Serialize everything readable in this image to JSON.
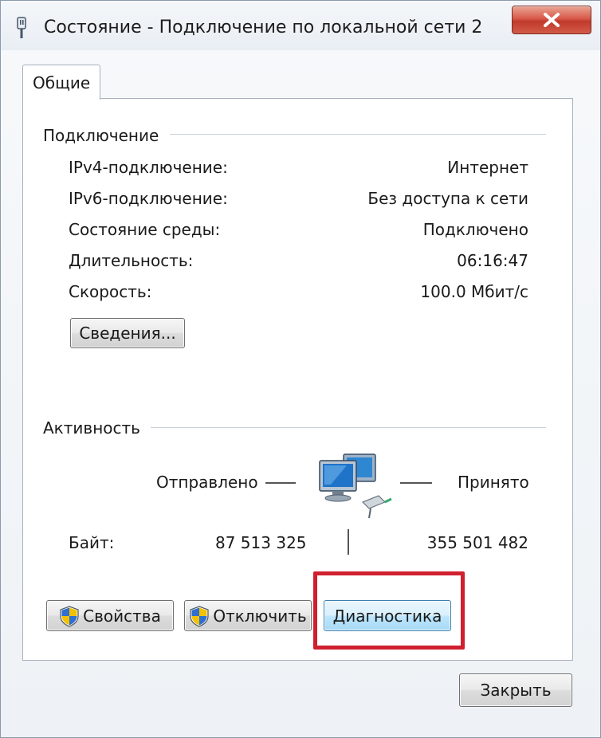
{
  "window": {
    "title": "Состояние - Подключение по локальной сети 2"
  },
  "icons": {
    "title": "network-connection-icon",
    "close": "close-x-icon",
    "activity": "network-computers-icon",
    "shield": "uac-shield-icon"
  },
  "colors": {
    "close_button": "#c7402f",
    "highlight": "#d0202f",
    "diag_button": "#bee6fd"
  },
  "tabs": [
    {
      "label": "Общие",
      "selected": true
    }
  ],
  "connection": {
    "group_label": "Подключение",
    "rows": [
      {
        "label": "IPv4-подключение:",
        "value": "Интернет"
      },
      {
        "label": "IPv6-подключение:",
        "value": "Без доступа к сети"
      },
      {
        "label": "Состояние среды:",
        "value": "Подключено"
      },
      {
        "label": "Длительность:",
        "value": "06:16:47"
      },
      {
        "label": "Скорость:",
        "value": "100.0 Мбит/с"
      }
    ],
    "details_button": "Сведения..."
  },
  "activity": {
    "group_label": "Активность",
    "sent_label": "Отправлено",
    "received_label": "Принято",
    "bytes_label": "Байт:",
    "bytes_sent": "87 513 325",
    "bytes_received": "355 501 482"
  },
  "buttons": {
    "properties": "Свойства",
    "disable": "Отключить",
    "diagnose": "Диагностика",
    "close": "Закрыть"
  }
}
